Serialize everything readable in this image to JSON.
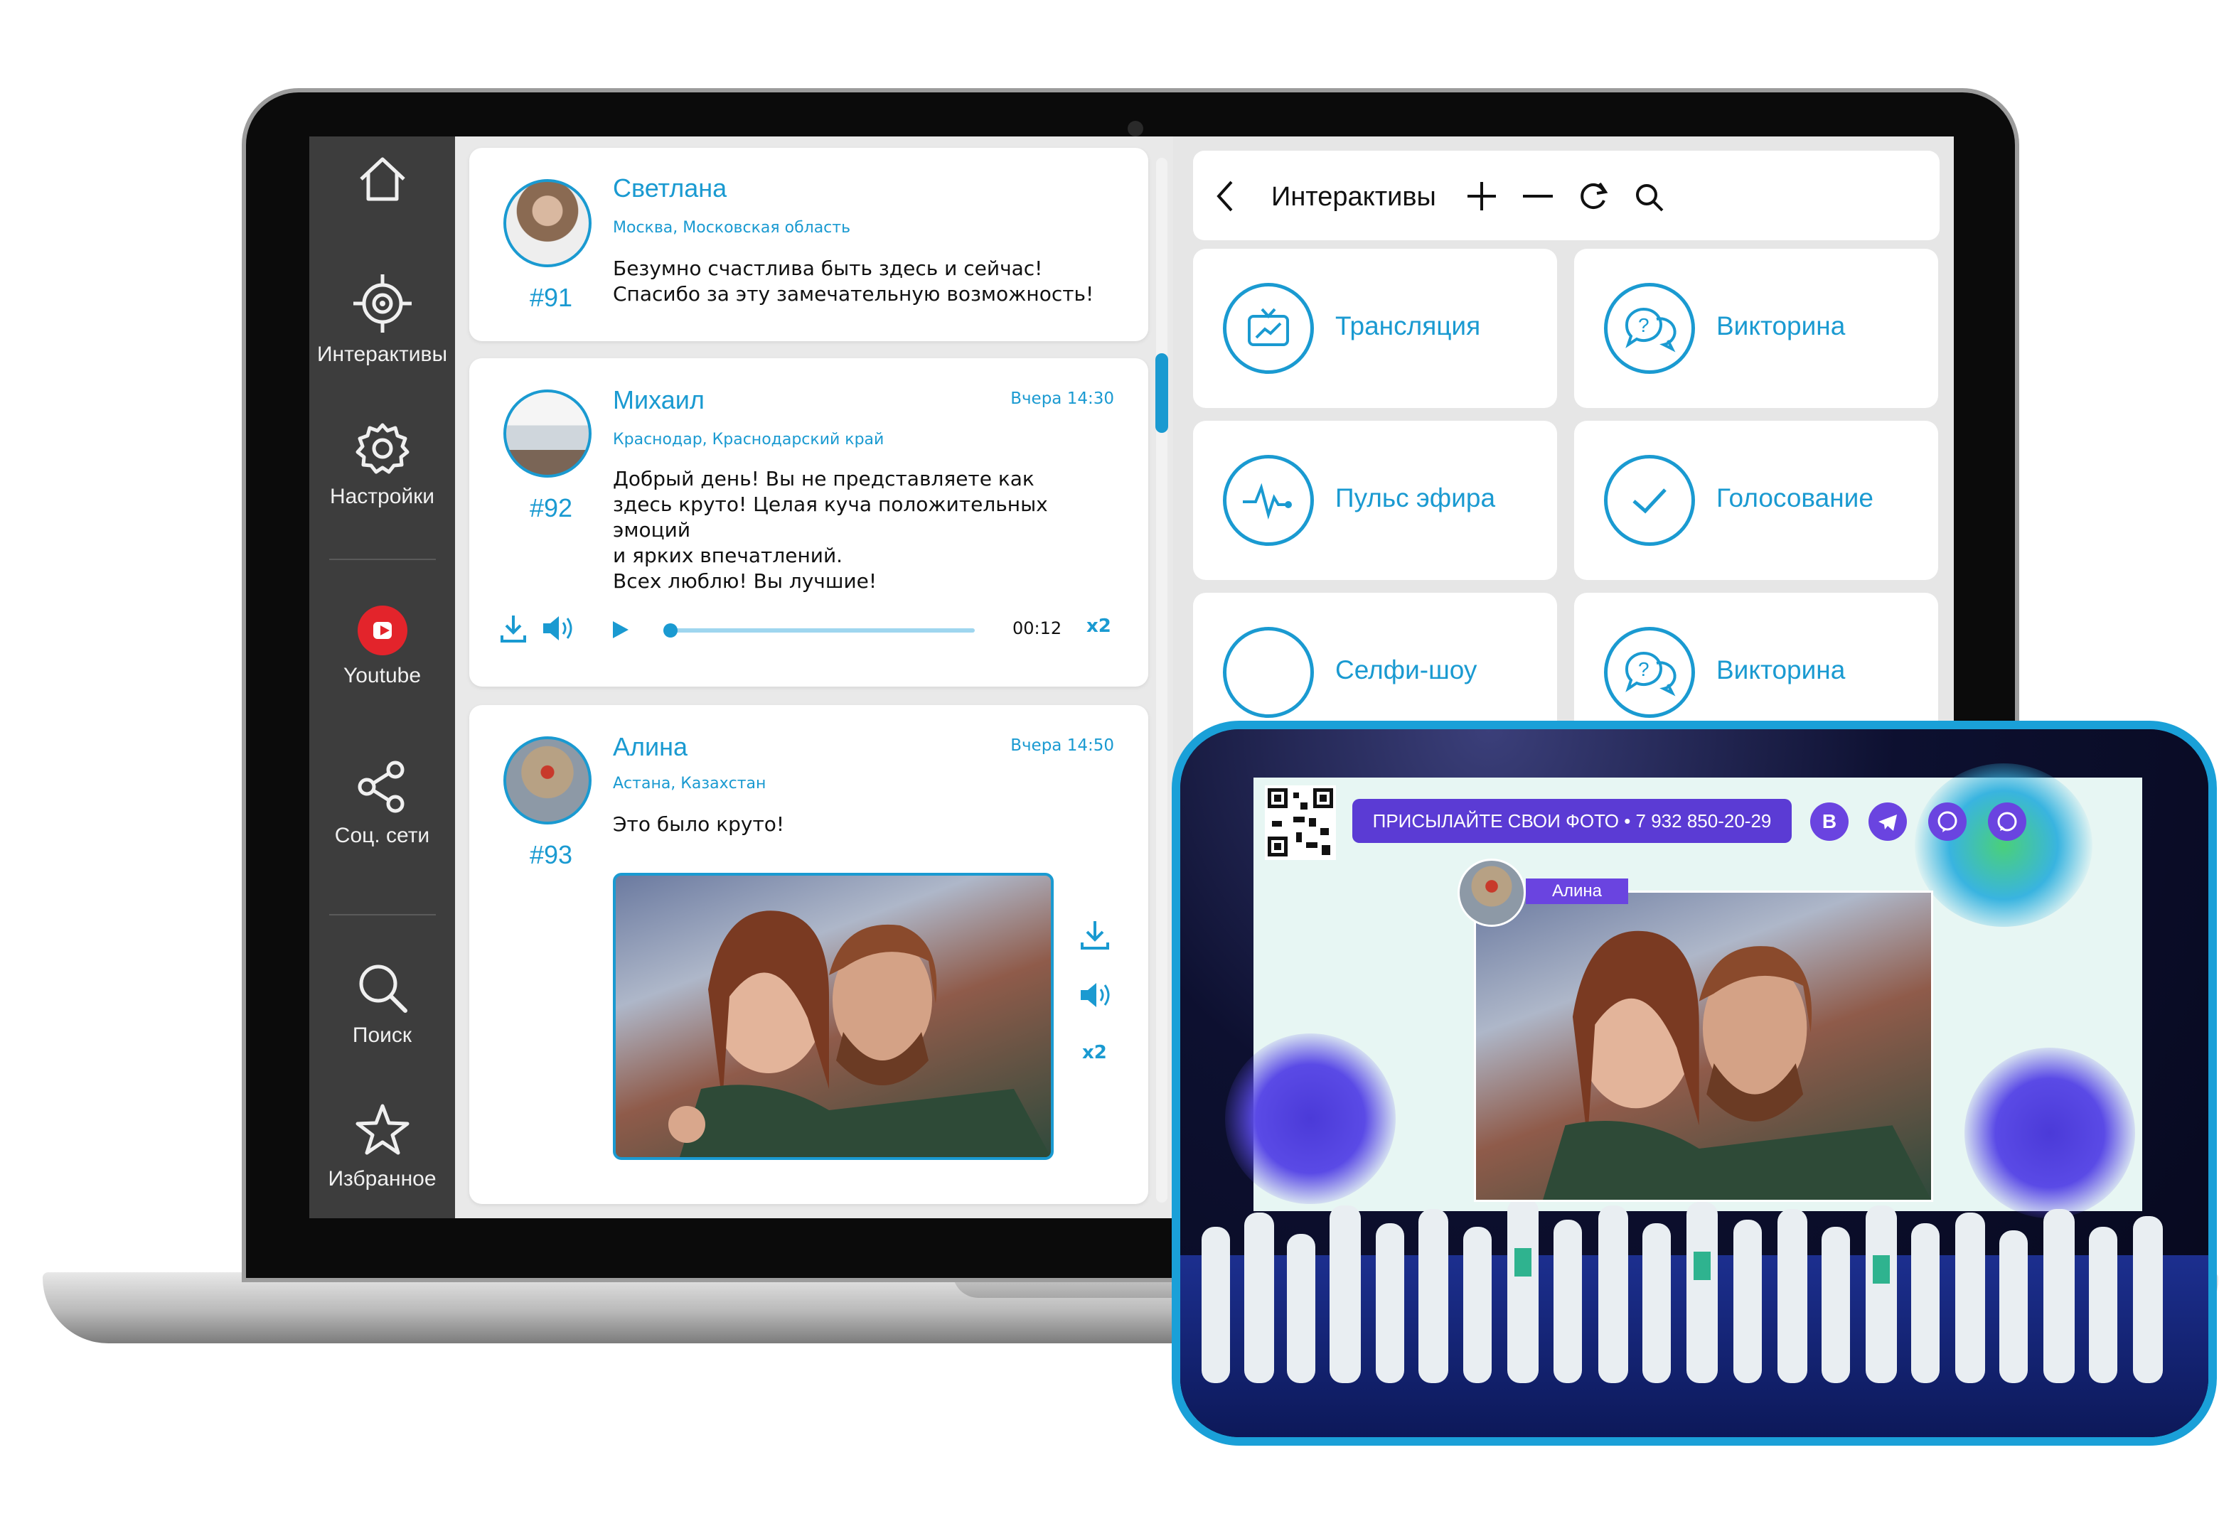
{
  "sidebar": {
    "items": [
      {
        "label": "",
        "icon": "home-icon"
      },
      {
        "label": "Интерактивы",
        "icon": "target-icon"
      },
      {
        "label": "Настройки",
        "icon": "gear-icon"
      },
      {
        "label": "Youtube",
        "icon": "youtube-icon"
      },
      {
        "label": "Соц. сети",
        "icon": "share-icon"
      },
      {
        "label": "Поиск",
        "icon": "search-icon"
      },
      {
        "label": "Избранное",
        "icon": "star-icon"
      }
    ]
  },
  "feed": {
    "posts": [
      {
        "name": "Светлана",
        "location": "Москва, Московская область",
        "time": "",
        "number": "#91",
        "text": "Безумно счастлива быть здесь и сейчас!\nСпасибо за эту замечательную возможность!"
      },
      {
        "name": "Михаил",
        "location": "Краснодар, Краснодарский край",
        "time": "Вчера 14:30",
        "number": "#92",
        "text": "Добрый день! Вы не представляете как\nздесь круто!  Целая куча положительных эмоций\nи ярких впечатлений.\n Всех люблю! Вы лучшие!",
        "audio": {
          "duration": "00:12",
          "speed": "x2",
          "progress": 0
        }
      },
      {
        "name": "Алина",
        "location": "Астана, Казахстан",
        "time": "Вчера 14:50",
        "number": "#93",
        "text": "Это было круто!",
        "media_speed": "x2"
      }
    ]
  },
  "panel": {
    "title": "Интерактивы",
    "tiles": [
      {
        "label": "Трансляция",
        "icon": "tv-icon"
      },
      {
        "label": "Викторина",
        "icon": "quiz-chat-icon"
      },
      {
        "label": "Пульс эфира",
        "icon": "pulse-icon"
      },
      {
        "label": "Голосование",
        "icon": "check-icon"
      },
      {
        "label": "Селфи-шоу",
        "icon": "selfie-icon"
      },
      {
        "label": "Викторина",
        "icon": "quiz-chat-icon"
      }
    ]
  },
  "stage": {
    "banner": "ПРИСЫЛАЙТЕ СВОИ ФОТО • 7 932 850-20-29",
    "social": [
      "В",
      "",
      "",
      ""
    ],
    "photo_name": "Алина"
  },
  "colors": {
    "accent": "#1a9ad1",
    "sidebar": "#3d3d3d",
    "stage_purple": "#6a44e0",
    "tablet_border": "#1aa0d8"
  }
}
